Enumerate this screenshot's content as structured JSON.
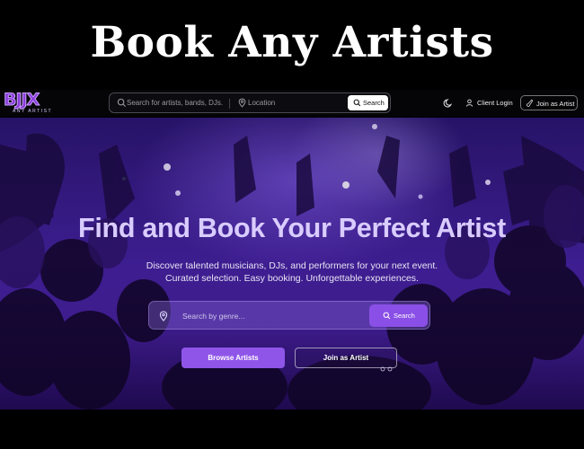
{
  "banner": {
    "title": "Book Any Artists"
  },
  "navbar": {
    "logo_text": "BJJX",
    "logo_subtext": "ANY ARTIST",
    "search": {
      "placeholder": "Search for artists, bands, DJs.",
      "location_placeholder": "Location",
      "button_label": "Search"
    },
    "theme_icon": "moon-icon",
    "client_login_label": "Client Login",
    "join_label": "Join as Artist"
  },
  "hero": {
    "title": "Find and Book Your Perfect Artist",
    "subtitle_line1": "Discover talented musicians, DJs, and performers for your next event.",
    "subtitle_line2": "Curated selection. Easy booking. Unforgettable experiences.",
    "search": {
      "placeholder": "Search by genre...",
      "button_label": "Search"
    },
    "browse_label": "Browse Artists",
    "join_label": "Join as Artist"
  },
  "colors": {
    "accent": "#8f55e8",
    "hero_title": "#d9ccff",
    "logo": "#8a3bd9"
  }
}
